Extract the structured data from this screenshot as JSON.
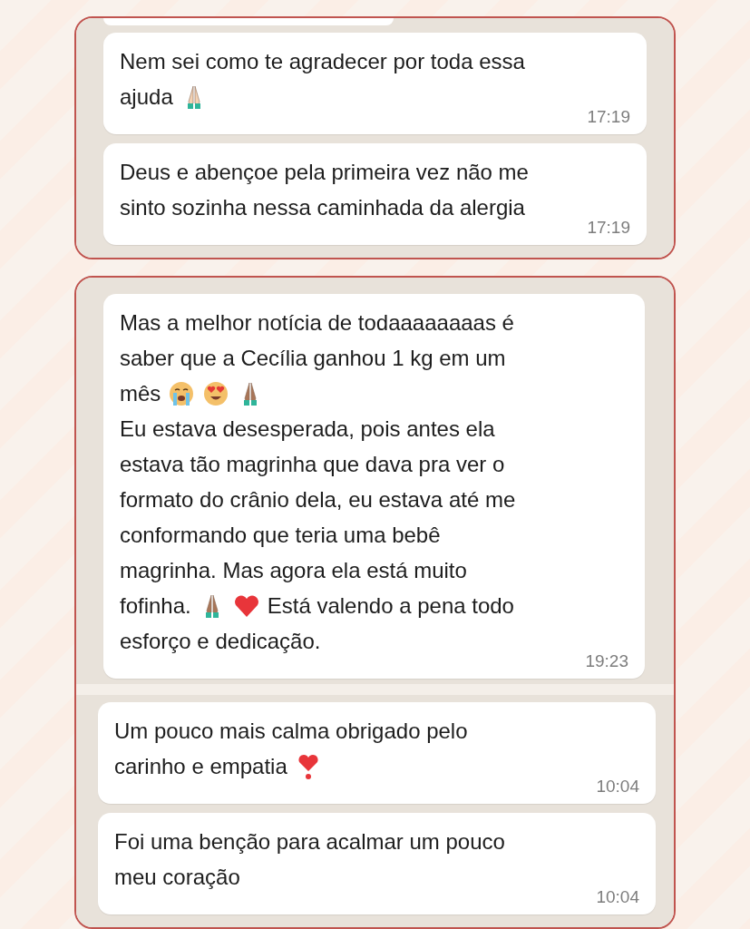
{
  "panels": [
    {
      "sections": [
        {
          "cut_top": true,
          "messages": [
            {
              "lines": [
                [
                  {
                    "kind": "text",
                    "text": "Nem sei como te agradecer por toda essa"
                  }
                ],
                [
                  {
                    "kind": "text",
                    "text": "ajuda"
                  },
                  {
                    "kind": "pray-light"
                  }
                ]
              ],
              "time": "17:19"
            },
            {
              "lines": [
                [
                  {
                    "kind": "text",
                    "text": "Deus e abençoe pela primeira vez não me"
                  }
                ],
                [
                  {
                    "kind": "text",
                    "text": "sinto sozinha nessa caminhada da alergia"
                  }
                ]
              ],
              "time": "17:19"
            }
          ]
        }
      ]
    },
    {
      "sections": [
        {
          "cut_top": false,
          "messages": [
            {
              "lines": [
                [
                  {
                    "kind": "text",
                    "text": "Mas a melhor notícia de todaaaaaaaas é"
                  }
                ],
                [
                  {
                    "kind": "text",
                    "text": "saber que a Cecília ganhou 1 kg em um"
                  }
                ],
                [
                  {
                    "kind": "text",
                    "text": "mês"
                  },
                  {
                    "kind": "crying-face"
                  },
                  {
                    "kind": "heart-eyes"
                  },
                  {
                    "kind": "pray-medium"
                  }
                ],
                [
                  {
                    "kind": "text",
                    "text": "Eu estava desesperada, pois antes ela"
                  }
                ],
                [
                  {
                    "kind": "text",
                    "text": "estava tão magrinha que dava pra ver o"
                  }
                ],
                [
                  {
                    "kind": "text",
                    "text": "formato do crânio dela, eu estava até me"
                  }
                ],
                [
                  {
                    "kind": "text",
                    "text": "conformando que teria uma bebê"
                  }
                ],
                [
                  {
                    "kind": "text",
                    "text": "magrinha. Mas agora ela está muito"
                  }
                ],
                [
                  {
                    "kind": "text",
                    "text": "fofinha."
                  },
                  {
                    "kind": "pray-medium"
                  },
                  {
                    "kind": "heart"
                  },
                  {
                    "kind": "text",
                    "text": "Está valendo a pena todo"
                  }
                ],
                [
                  {
                    "kind": "text",
                    "text": "esforço e dedicação."
                  }
                ]
              ],
              "time": "19:23"
            }
          ]
        },
        {
          "cut_top": false,
          "messages": [
            {
              "lines": [
                [
                  {
                    "kind": "text",
                    "text": "Um pouco mais calma obrigado pelo"
                  }
                ],
                [
                  {
                    "kind": "text",
                    "text": "carinho e empatia"
                  },
                  {
                    "kind": "heart-exclamation"
                  }
                ]
              ],
              "time": "10:04"
            },
            {
              "lines": [
                [
                  {
                    "kind": "text",
                    "text": "Foi uma benção para acalmar um pouco"
                  }
                ],
                [
                  {
                    "kind": "text",
                    "text": "meu coração"
                  }
                ]
              ],
              "time": "10:04"
            }
          ]
        }
      ]
    }
  ]
}
